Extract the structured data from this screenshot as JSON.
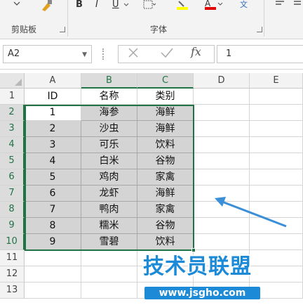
{
  "ribbon": {
    "clipboard_group": "剪贴板",
    "font_group": "字体",
    "bold": "B",
    "italic": "I",
    "underline": "U",
    "wen": "文"
  },
  "formula_bar": {
    "name_box": "A2",
    "fx": "fx",
    "formula_value": "1"
  },
  "sheet": {
    "columns": [
      "A",
      "B",
      "C",
      "D",
      "E"
    ],
    "rows": [
      "1",
      "2",
      "3",
      "4",
      "5",
      "6",
      "7",
      "8",
      "9",
      "10",
      "11",
      "12",
      "13"
    ],
    "header_row": [
      "ID",
      "名称",
      "类别"
    ],
    "data": [
      [
        "1",
        "海参",
        "海鲜"
      ],
      [
        "2",
        "沙虫",
        "海鲜"
      ],
      [
        "3",
        "可乐",
        "饮料"
      ],
      [
        "4",
        "白米",
        "谷物"
      ],
      [
        "5",
        "鸡肉",
        "家禽"
      ],
      [
        "6",
        "龙虾",
        "海鲜"
      ],
      [
        "7",
        "鸭肉",
        "家禽"
      ],
      [
        "8",
        "糯米",
        "谷物"
      ],
      [
        "9",
        "雪碧",
        "饮料"
      ]
    ]
  },
  "watermark": {
    "title": "技术员联盟",
    "url": "www.jsgho.com"
  },
  "colors": {
    "accent": "#217346",
    "arrow": "#3a8fd8",
    "selection_fill": "#d4d4d4"
  }
}
